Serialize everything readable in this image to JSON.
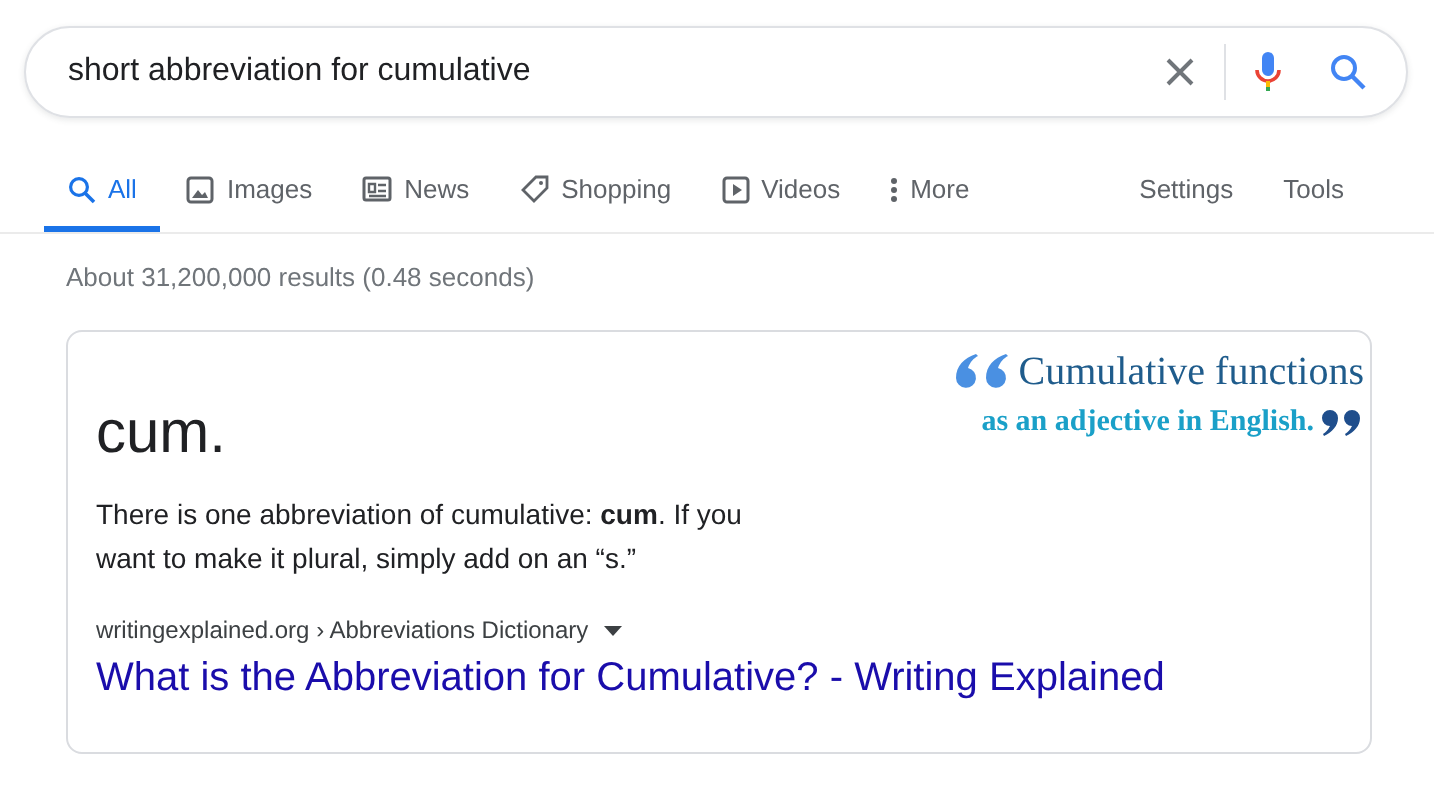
{
  "search": {
    "value": "short abbreviation for cumulative"
  },
  "tabs": [
    {
      "label": "All",
      "kind": "search",
      "selected": true
    },
    {
      "label": "Images",
      "kind": "image",
      "selected": false
    },
    {
      "label": "News",
      "kind": "news",
      "selected": false
    },
    {
      "label": "Shopping",
      "kind": "tag",
      "selected": false
    },
    {
      "label": "Videos",
      "kind": "video",
      "selected": false
    },
    {
      "label": "More",
      "kind": "dots",
      "selected": false
    }
  ],
  "tools": [
    "Settings",
    "Tools"
  ],
  "result_stats": "About 31,200,000 results (0.48 seconds)",
  "snippet": {
    "answer": "cum.",
    "text": "There is one abbreviation of cumulative: **cum**. If you want to make it plural, simply add on an “s.”",
    "image_text": [
      "Cumulative functions",
      "as an adjective in English."
    ],
    "breadcrumb": "writingexplained.org › Abbreviations Dictionary",
    "title": "What is the Abbreviation for Cumulative? - Writing Explained"
  }
}
